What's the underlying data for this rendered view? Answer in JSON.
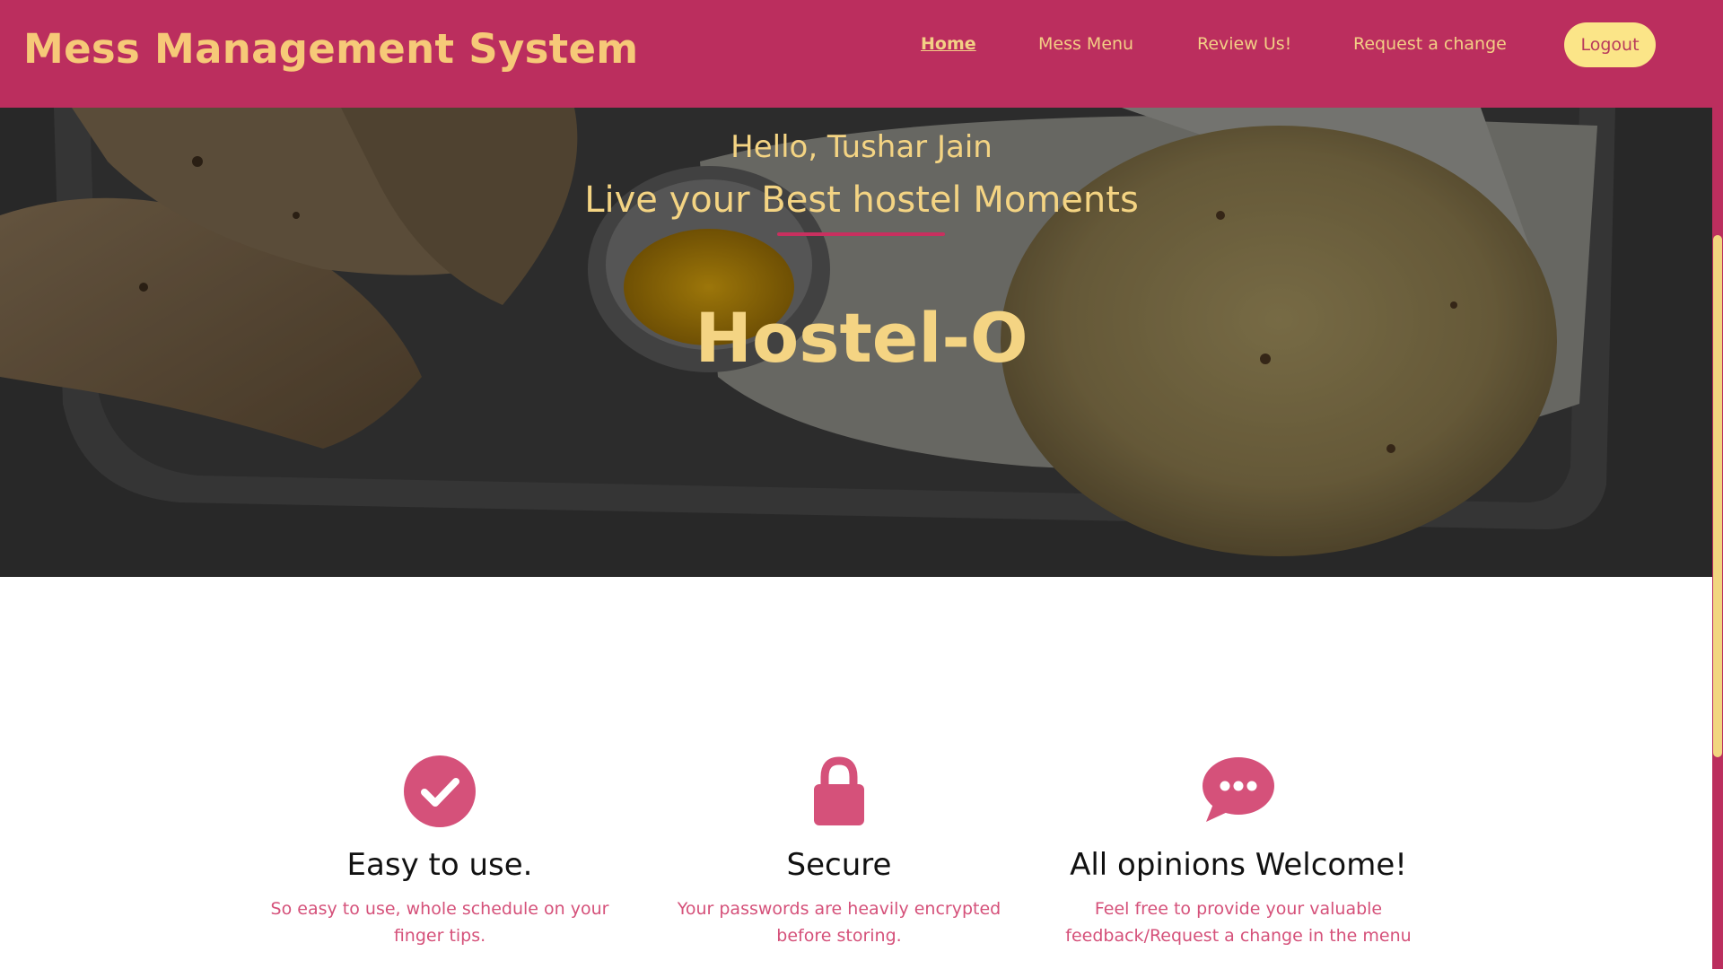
{
  "navbar": {
    "brand": "Mess Management System",
    "links": [
      {
        "label": "Home",
        "active": true
      },
      {
        "label": "Mess Menu",
        "active": false
      },
      {
        "label": "Review Us!",
        "active": false
      },
      {
        "label": "Request a change",
        "active": false
      }
    ],
    "logout_label": "Logout"
  },
  "hero": {
    "greeting": "Hello, Tushar Jain",
    "tagline": "Live your Best hostel Moments",
    "title": "Hostel-O"
  },
  "features": [
    {
      "icon": "check-circle-icon",
      "heading": "Easy to use.",
      "line1": "So easy to use, whole schedule on your",
      "line2": "finger tips."
    },
    {
      "icon": "lock-icon",
      "heading": "Secure",
      "line1": "Your passwords are heavily encrypted",
      "line2": "before storing."
    },
    {
      "icon": "chat-bubble-icon",
      "heading": "All opinions Welcome!",
      "line1": "Feel free to provide your valuable",
      "line2": "feedback/Request a change in the menu"
    }
  ],
  "colors": {
    "primary": "#bb2e5e",
    "accent_text": "#f4d483",
    "button_bg": "#fbe588",
    "icon": "#d5517a"
  }
}
